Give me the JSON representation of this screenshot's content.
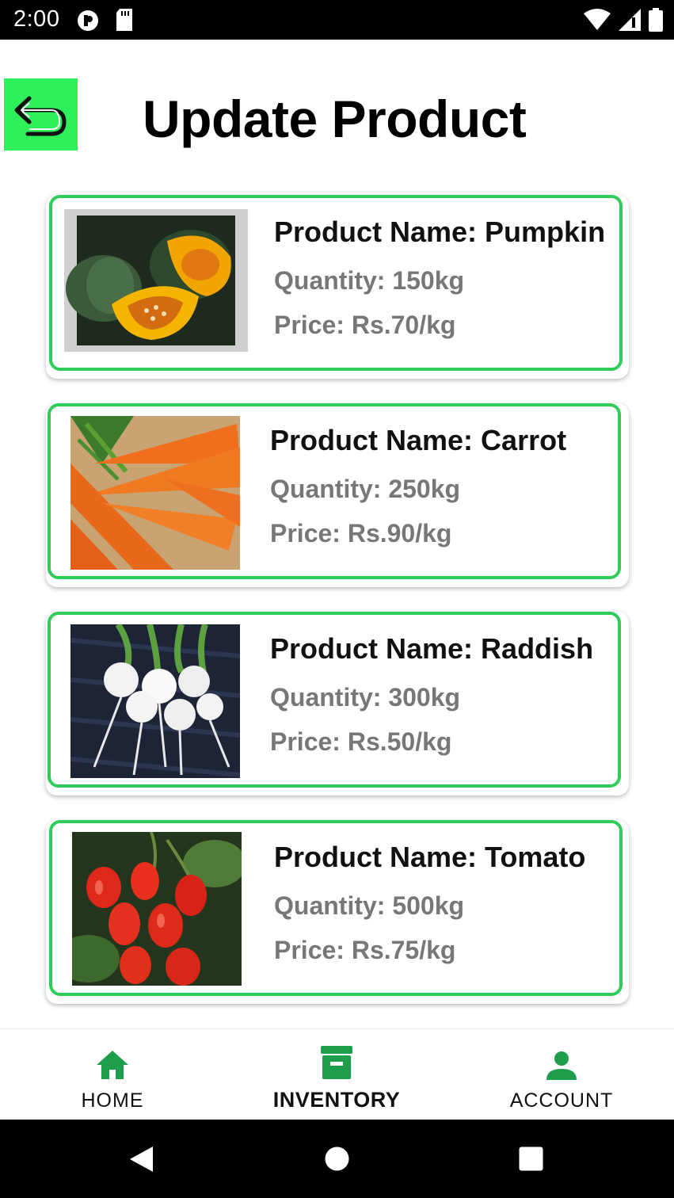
{
  "status_bar": {
    "time": "2:00",
    "icons": [
      "app-notification-icon",
      "sd-card-icon",
      "wifi-icon",
      "cellular-signal-icon",
      "battery-icon"
    ]
  },
  "header": {
    "back_icon": "undo-arrow-icon",
    "title": "Update Product"
  },
  "products": [
    {
      "name": "Product Name: Pumpkin",
      "quantity": "Quantity: 150kg",
      "price": "Price: Rs.70/kg",
      "image": "pumpkin"
    },
    {
      "name": "Product Name: Carrot",
      "quantity": "Quantity: 250kg",
      "price": "Price: Rs.90/kg",
      "image": "carrot"
    },
    {
      "name": "Product Name: Raddish",
      "quantity": "Quantity: 300kg",
      "price": "Price: Rs.50/kg",
      "image": "radish"
    },
    {
      "name": "Product Name: Tomato",
      "quantity": "Quantity: 500kg",
      "price": "Price: Rs.75/kg",
      "image": "tomato"
    }
  ],
  "bottom_nav": {
    "items": [
      {
        "label": "HOME",
        "icon": "home-icon"
      },
      {
        "label": "INVENTORY",
        "icon": "archive-icon",
        "active": true
      },
      {
        "label": "ACCOUNT",
        "icon": "person-icon"
      }
    ]
  },
  "system_nav": {
    "buttons": [
      "back-triangle-icon",
      "home-circle-icon",
      "recents-square-icon"
    ]
  },
  "colors": {
    "accent_green": "#2ecc58",
    "back_button_green": "#2ef05a",
    "nav_icon_green": "#1e9e4a",
    "secondary_text": "#777777"
  }
}
